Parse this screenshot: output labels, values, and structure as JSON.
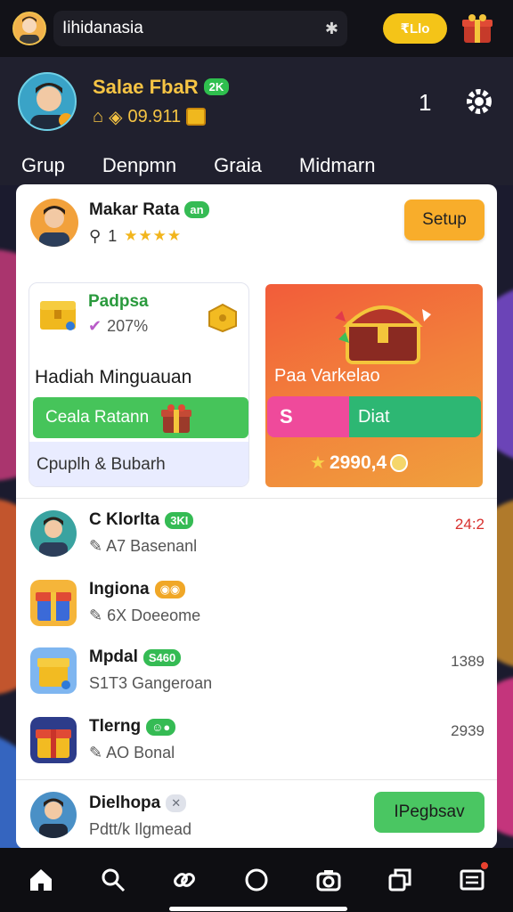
{
  "topbar": {
    "search_value": "Iihidanasia",
    "coin_pill": "₹Llo",
    "icons": [
      "avatar",
      "clear-icon",
      "gift-icon"
    ]
  },
  "profile": {
    "name": "Salae FbaR",
    "badge": "2K",
    "balance": "09.911",
    "count": "1"
  },
  "tabs": [
    "Grup",
    "Denpmn",
    "Graia",
    "Midmarn"
  ],
  "owner": {
    "name": "Makar Rata",
    "badge": "an",
    "sub_num": "1",
    "setup_label": "Setup"
  },
  "panel_left": {
    "title": "Padpsa",
    "percent": "207%",
    "heading": "Hadiah Minguauan",
    "button_label": "Ceala Ratann",
    "footer": "Cpuplh & Bubarh"
  },
  "panel_right": {
    "title": "Paa Varkelao",
    "bar_left": "S",
    "bar_right": "Diat",
    "amount": "2990,4"
  },
  "rows": [
    {
      "name": "C Klorlta",
      "chip": "3KI",
      "chip_color": "green",
      "sub": "A7 Basenanl",
      "value": "24:2",
      "value_red": true
    },
    {
      "name": "Ingiona",
      "chip": "",
      "chip_color": "orange",
      "sub": "6X Doeeome",
      "value": ""
    },
    {
      "name": "Mpdal",
      "chip": "S460",
      "chip_color": "green",
      "sub": "S1T3 Gangeroan",
      "value": "1389"
    },
    {
      "name": "Tlerng",
      "chip": "",
      "chip_color": "green",
      "sub": "AO Bonal",
      "value": "2939"
    }
  ],
  "bottom_owner": {
    "name": "Dielhopa",
    "sub": "Pdtt/k Ilgmead",
    "button_label": "IPegbsav"
  },
  "colors": {
    "accent_yellow": "#f6c444",
    "green": "#46c45a",
    "orange": "#f8ad2b",
    "pink": "#ef4a9b"
  }
}
